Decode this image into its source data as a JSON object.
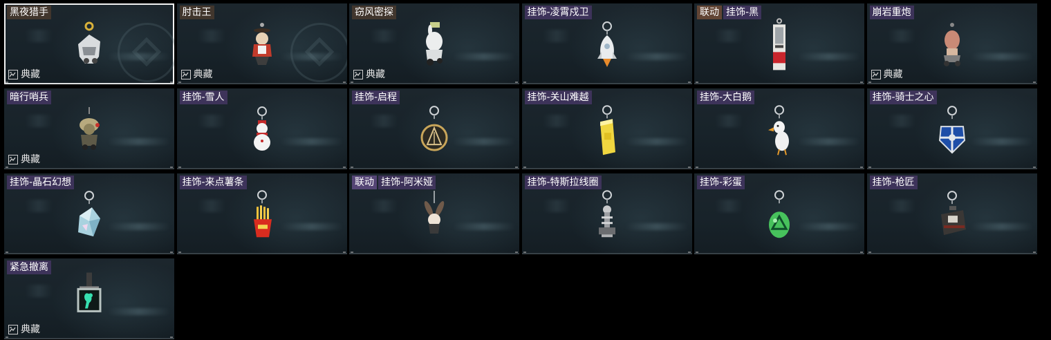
{
  "collection_label": "典藏",
  "items": [
    {
      "title": "黑夜猎手",
      "tag": "",
      "tone": "brown",
      "collection": true,
      "selected": true,
      "icon": "hunter-figure-icon",
      "emblem": true
    },
    {
      "title": "肘击王",
      "tag": "",
      "tone": "brown",
      "collection": true,
      "selected": false,
      "icon": "elbow-king-figure-icon",
      "emblem": true
    },
    {
      "title": "窃风密探",
      "tag": "",
      "tone": "brown",
      "collection": true,
      "selected": false,
      "icon": "spy-rabbit-figure-icon",
      "emblem": false
    },
    {
      "title": "挂饰-凌霄戍卫",
      "tag": "",
      "tone": "purple",
      "collection": false,
      "selected": false,
      "icon": "rocket-charm-icon",
      "emblem": false
    },
    {
      "title": "挂饰-黑",
      "tag": "联动",
      "tone": "purple",
      "collection": false,
      "selected": false,
      "icon": "card-charm-icon",
      "emblem": false
    },
    {
      "title": "崩岩重炮",
      "tag": "",
      "tone": "purple",
      "collection": true,
      "selected": false,
      "icon": "cannon-figure-icon",
      "emblem": false
    },
    {
      "title": "暗行哨兵",
      "tag": "",
      "tone": "purple",
      "collection": true,
      "selected": false,
      "icon": "sentinel-figure-icon",
      "emblem": false
    },
    {
      "title": "挂饰-雪人",
      "tag": "",
      "tone": "purple",
      "collection": false,
      "selected": false,
      "icon": "snowman-charm-icon",
      "emblem": false
    },
    {
      "title": "挂饰-启程",
      "tag": "",
      "tone": "purple",
      "collection": false,
      "selected": false,
      "icon": "medal-charm-icon",
      "emblem": false
    },
    {
      "title": "挂饰-关山难越",
      "tag": "",
      "tone": "purple",
      "collection": false,
      "selected": false,
      "icon": "yellow-can-charm-icon",
      "emblem": false
    },
    {
      "title": "挂饰-大白鹅",
      "tag": "",
      "tone": "purple",
      "collection": false,
      "selected": false,
      "icon": "goose-charm-icon",
      "emblem": false
    },
    {
      "title": "挂饰-骑士之心",
      "tag": "",
      "tone": "purple",
      "collection": false,
      "selected": false,
      "icon": "knight-shield-charm-icon",
      "emblem": false
    },
    {
      "title": "挂饰-晶石幻想",
      "tag": "",
      "tone": "purple",
      "collection": false,
      "selected": false,
      "icon": "crystal-charm-icon",
      "emblem": false
    },
    {
      "title": "挂饰-来点薯条",
      "tag": "",
      "tone": "purple",
      "collection": false,
      "selected": false,
      "icon": "fries-charm-icon",
      "emblem": false
    },
    {
      "title": "挂饰-阿米娅",
      "tag": "联动",
      "tone": "purple",
      "collection": false,
      "selected": false,
      "icon": "amiya-charm-icon",
      "emblem": false
    },
    {
      "title": "挂饰-特斯拉线圈",
      "tag": "",
      "tone": "purple",
      "collection": false,
      "selected": false,
      "icon": "tesla-coil-charm-icon",
      "emblem": false
    },
    {
      "title": "挂饰-彩蛋",
      "tag": "",
      "tone": "purple",
      "collection": false,
      "selected": false,
      "icon": "green-egg-charm-icon",
      "emblem": false
    },
    {
      "title": "挂饰-枪匠",
      "tag": "",
      "tone": "purple",
      "collection": false,
      "selected": false,
      "icon": "gunsmith-case-charm-icon",
      "emblem": false
    },
    {
      "title": "紧急撤离",
      "tag": "",
      "tone": "purple",
      "collection": true,
      "selected": false,
      "icon": "exit-sign-charm-icon",
      "emblem": false
    }
  ]
}
